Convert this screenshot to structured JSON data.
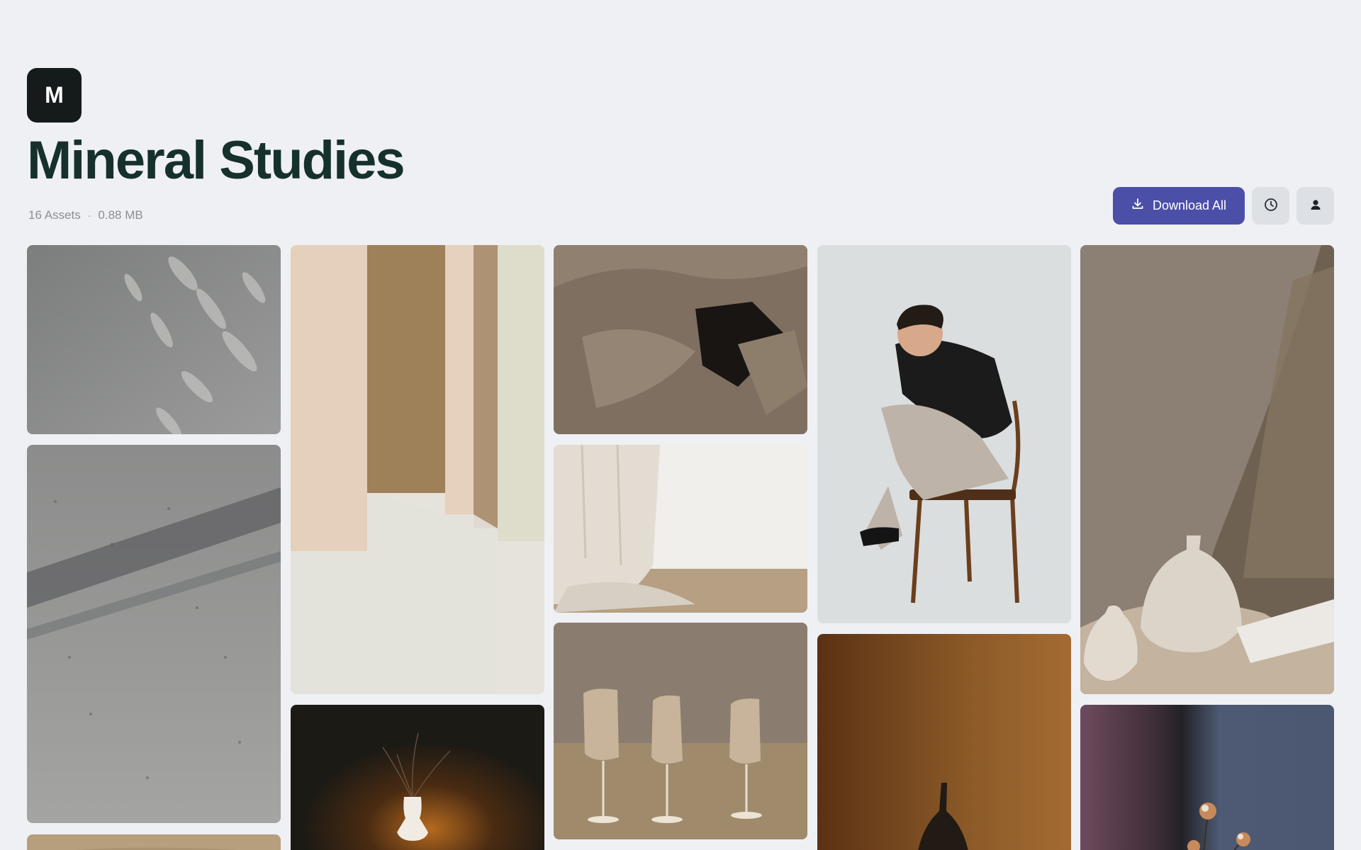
{
  "brand": {
    "logo_letter": "M"
  },
  "page": {
    "title": "Mineral Studies",
    "asset_count": "16 Assets",
    "separator": "·",
    "size": "0.88 MB"
  },
  "actions": {
    "download_label": "Download All",
    "download_icon": "download-icon",
    "history_icon": "clock-icon",
    "profile_icon": "user-icon",
    "accent": "#4b4fa8"
  },
  "assets": [
    {
      "name": "concrete-leaf-shadows"
    },
    {
      "name": "beige-pillars-render"
    },
    {
      "name": "folded-linen-fabric"
    },
    {
      "name": "man-seated-on-chair"
    },
    {
      "name": "vases-with-drapery"
    },
    {
      "name": "concrete-wall-shadow"
    },
    {
      "name": "sheer-curtain-floor"
    },
    {
      "name": "dried-flowers-vase-dark"
    },
    {
      "name": "three-chairs-studio"
    },
    {
      "name": "dark-vase-amber-wall"
    },
    {
      "name": "cotton-stems-blue"
    },
    {
      "name": "tan-fabric-corner"
    }
  ]
}
